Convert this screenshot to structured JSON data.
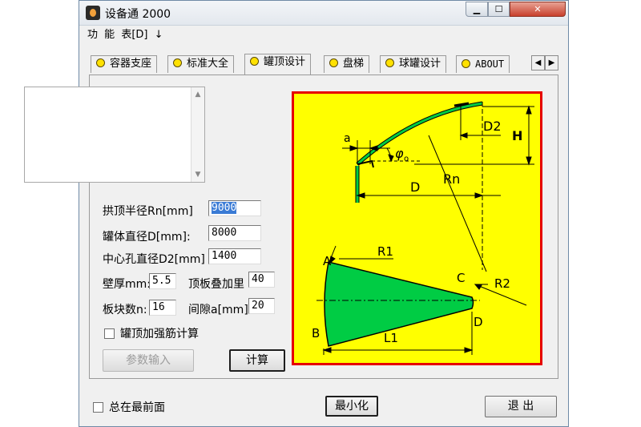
{
  "window": {
    "title": "设备通 2000"
  },
  "menu": {
    "items": [
      "功",
      "能",
      "表[D]",
      "↓"
    ]
  },
  "tabs": [
    {
      "label": "容器支座",
      "active": false
    },
    {
      "label": "标准大全",
      "active": false
    },
    {
      "label": "罐顶设计",
      "active": true
    },
    {
      "label": "盘梯",
      "active": false
    },
    {
      "label": "球罐设计",
      "active": false
    },
    {
      "label": "ABOUT",
      "active": false
    }
  ],
  "form": {
    "rn_label": "拱顶半径Rn[mm]",
    "rn_value": "9000",
    "d_label": "罐体直径D[mm]:",
    "d_value": "8000",
    "d2_label": "中心孔直径D2[mm]",
    "d2_value": "1400",
    "thick_label": "壁厚mm:",
    "thick_value": "5.5",
    "overlap_label": "顶板叠加里",
    "overlap_value": "40",
    "blocks_label": "板块数n:",
    "blocks_value": "16",
    "gap_label": "间隙a[mm]:",
    "gap_value": "20",
    "rib_label": "罐顶加强筋计算"
  },
  "buttons": {
    "param": "参数输入",
    "calc": "计算",
    "minimize": "最小化",
    "exit": "退  出"
  },
  "footer": {
    "topmost_label": "总在最前面"
  },
  "diagram": {
    "labels": {
      "a": "a",
      "phi": "φ",
      "phi_sub": "o",
      "D": "D",
      "Rn": "Rn",
      "D2": "D2",
      "H": "H",
      "R1": "R1",
      "R2": "R2",
      "A": "A",
      "B": "B",
      "C": "C",
      "Dp": "D",
      "L1": "L1"
    },
    "colors": {
      "background": "#ffff00",
      "border": "#e60000",
      "shell": "#00cc44"
    }
  }
}
